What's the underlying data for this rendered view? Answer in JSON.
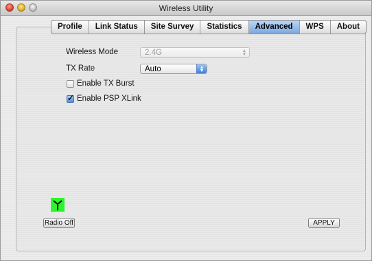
{
  "window": {
    "title": "Wireless Utility"
  },
  "tabs": [
    {
      "label": "Profile"
    },
    {
      "label": "Link Status"
    },
    {
      "label": "Site Survey"
    },
    {
      "label": "Statistics"
    },
    {
      "label": "Advanced"
    },
    {
      "label": "WPS"
    },
    {
      "label": "About"
    }
  ],
  "active_tab": "Advanced",
  "advanced": {
    "wireless_mode": {
      "label": "Wireless Mode",
      "value": "2.4G",
      "enabled": false
    },
    "tx_rate": {
      "label": "TX Rate",
      "value": "Auto"
    },
    "tx_burst": {
      "label": "Enable TX Burst",
      "checked": false
    },
    "psp_xlink": {
      "label": "Enable PSP XLink",
      "checked": true
    }
  },
  "buttons": {
    "radio_off": "Radio Off",
    "apply": "APPLY"
  },
  "radio_indicator": {
    "icon": "antenna-icon",
    "color": "#2cf52c"
  }
}
